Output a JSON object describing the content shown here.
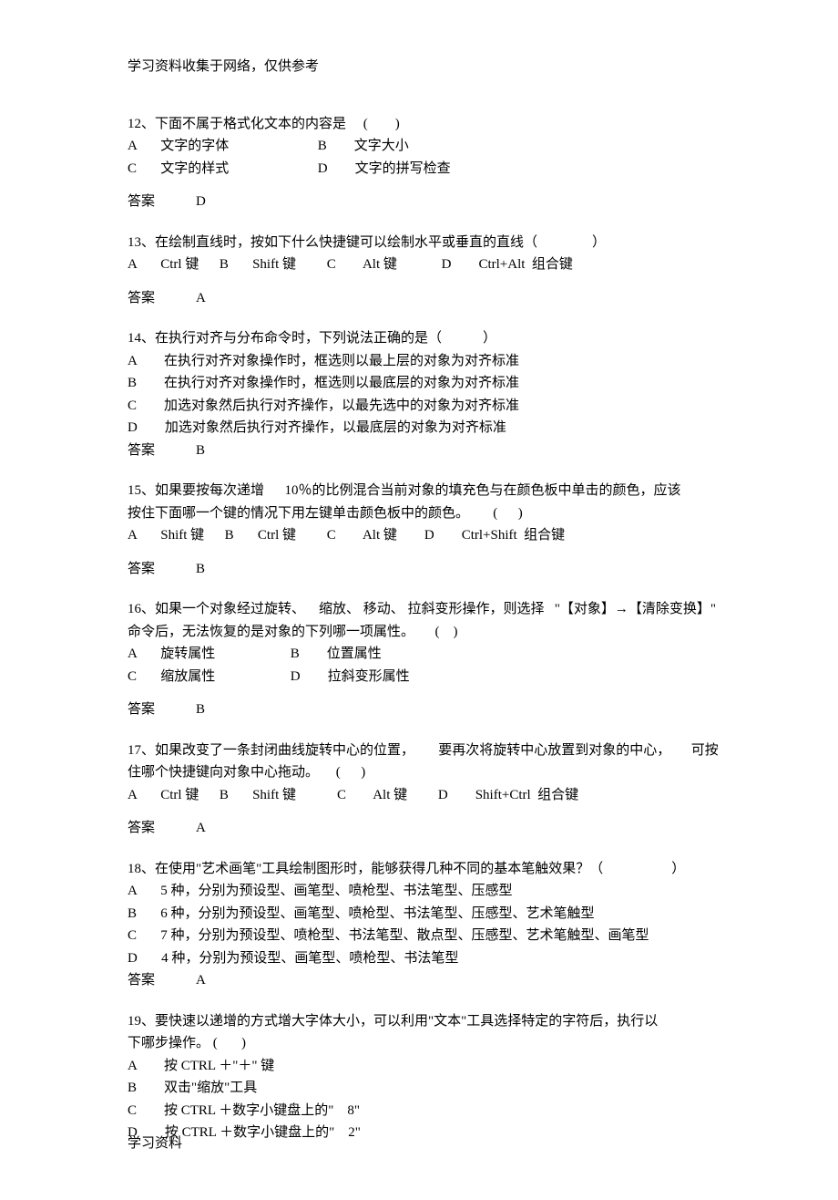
{
  "header": "学习资料收集于网络，仅供参考",
  "footer": "学习资料",
  "questions": [
    {
      "stem": "12、下面不属于格式化文本的内容是     (        )",
      "opts": [
        "A       文字的字体                          B        文字大小",
        "C       文字的样式                          D        文字的拼写检查"
      ],
      "ans": "答案            D"
    },
    {
      "stem": "13、在绘制直线时，按如下什么快捷键可以绘制水平或垂直的直线（                ）",
      "opts": [
        "A       Ctrl 键      B       Shift 键         C        Alt 键             D        Ctrl+Alt  组合键"
      ],
      "ans": "答案            A"
    },
    {
      "stem": "14、在执行对齐与分布命令时，下列说法正确的是（            ）",
      "opts": [
        "A        在执行对齐对象操作时，框选则以最上层的对象为对齐标准",
        "B        在执行对齐对象操作时，框选则以最底层的对象为对齐标准",
        "C        加选对象然后执行对齐操作，以最先选中的对象为对齐标准",
        "D        加选对象然后执行对齐操作，以最底层的对象为对齐标准"
      ],
      "ans": "答案            B",
      "tightAns": true
    },
    {
      "stem": "15、如果要按每次递增      10％的比例混合当前对象的填充色与在颜色板中单击的颜色，应该",
      "stemExtra": "按住下面哪一个键的情况下用左键单击颜色板中的颜色。       (      )",
      "opts": [
        "A       Shift 键      B       Ctrl 键         C        Alt 键        D        Ctrl+Shift  组合键"
      ],
      "ans": "答案            B"
    },
    {
      "stem": "16、如果一个对象经过旋转、    缩放、 移动、 拉斜变形操作，则选择   \"【对象】→【清除变换】\"",
      "stemExtra": "命令后，无法恢复的是对象的下列哪一项属性。      (    )",
      "opts": [
        "A       旋转属性                      B        位置属性",
        "C       缩放属性                      D        拉斜变形属性"
      ],
      "ans": "答案            B"
    },
    {
      "stem": "17、如果改变了一条封闭曲线旋转中心的位置，       要再次将旋转中心放置到对象的中心，      可按",
      "stemExtra": "住哪个快捷键向对象中心拖动。     (      )",
      "opts": [
        "A       Ctrl 键      B       Shift 键            C        Alt 键         D        Shift+Ctrl  组合键"
      ],
      "ans": "答案            A"
    },
    {
      "stem": "18、在使用\"艺术画笔\"工具绘制图形时，能够获得几种不同的基本笔触效果？（                    ）",
      "opts": [
        "A       5 种，分别为预设型、画笔型、喷枪型、书法笔型、压感型",
        "B       6 种，分别为预设型、画笔型、喷枪型、书法笔型、压感型、艺术笔触型",
        "C       7 种，分别为预设型、喷枪型、书法笔型、散点型、压感型、艺术笔触型、画笔型",
        "D       4 种，分别为预设型、画笔型、喷枪型、书法笔型"
      ],
      "ans": "答案            A",
      "tightAns": true
    },
    {
      "stem": "19、要快速以递增的方式增大字体大小，可以利用\"文本\"工具选择特定的字符后，执行以",
      "stemExtra": "下哪步操作。 (       )",
      "opts": [
        "A        按 CTRL ＋\"＋\" 键",
        "B        双击\"缩放\"工具",
        "C        按 CTRL ＋数字小键盘上的\"    8\"",
        "D        按 CTRL ＋数字小键盘上的\"    2\""
      ],
      "gapBefore": true
    }
  ]
}
